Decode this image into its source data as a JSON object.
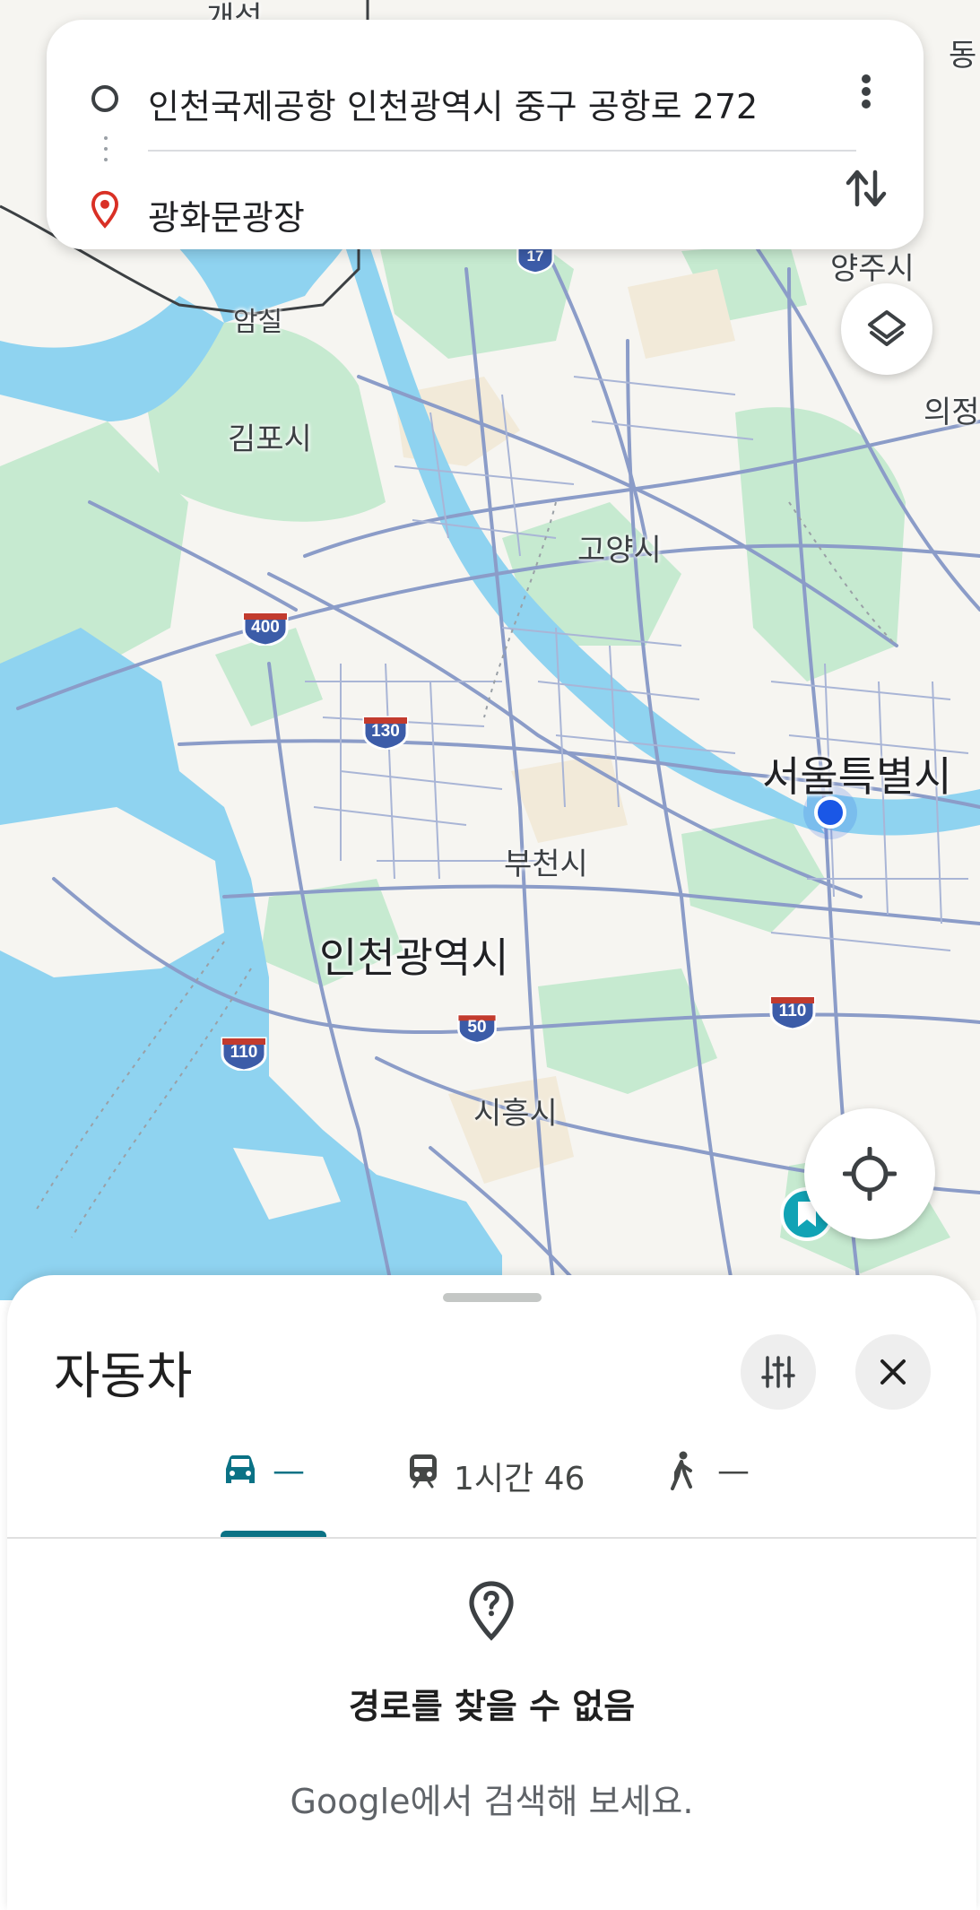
{
  "route": {
    "origin": "인천국제공항 인천광역시 중구 공항로 272",
    "destination": "광화문광장"
  },
  "map": {
    "labels": {
      "gaeseong": "개성",
      "dong": "동",
      "amsil": "암실",
      "yangju": "양주시",
      "uijeongbu": "의정",
      "gimpo": "김포시",
      "goyang": "고양시",
      "seoul": "서울특별시",
      "bucheon": "부천시",
      "incheon": "인천광역시",
      "siheung": "시흥시"
    },
    "shields": {
      "r17": "17",
      "r400": "400",
      "r130": "130",
      "r50": "50",
      "r110_west": "110",
      "r110_east": "110"
    },
    "colors": {
      "water": "#8fd3f0",
      "park": "#c8ebd2",
      "road": "#8b9cc8",
      "shield_blue": "#3c5ca8",
      "shield_red": "#c23b2e",
      "location_dot": "#1a57e6"
    }
  },
  "sheet": {
    "title": "자동차",
    "tabs": [
      {
        "mode": "car-icon",
        "label": "—"
      },
      {
        "mode": "train-icon",
        "label": "1시간 46"
      },
      {
        "mode": "walk-icon",
        "label": "—"
      }
    ],
    "no_route_title": "경로를 찾을 수 없음",
    "no_route_subtitle": "Google에서 검색해 보세요.",
    "accent": "#0b7285"
  }
}
